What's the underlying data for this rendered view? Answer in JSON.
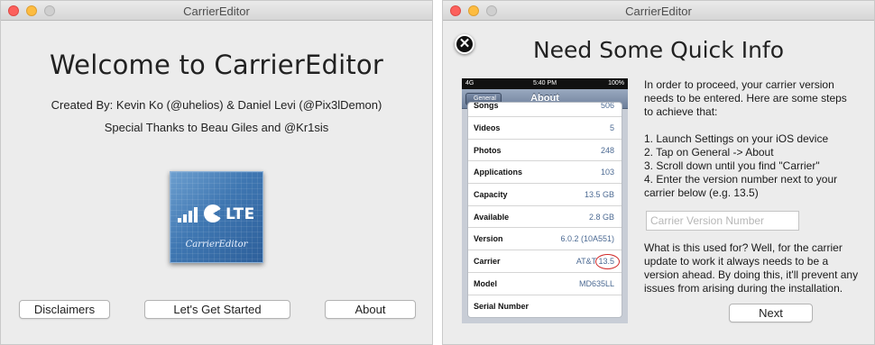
{
  "left_window": {
    "title": "CarrierEditor",
    "heading": "Welcome to CarrierEditor",
    "created_by": "Created By: Kevin Ko (@uhelios) & Daniel Levi (@Pix3lDemon)",
    "thanks": "Special Thanks to Beau Giles and @Kr1sis",
    "icon": {
      "name": "carriereditor-app-icon",
      "badge": "LTE",
      "label": "CarrierEditor"
    },
    "buttons": {
      "disclaimers": "Disclaimers",
      "started": "Let's Get Started",
      "about": "About"
    }
  },
  "right_window": {
    "title": "CarrierEditor",
    "heading": "Need Some Quick Info",
    "close_icon": "close-icon",
    "phone": {
      "status": {
        "network": "4G",
        "time": "5:40 PM",
        "battery": "100%"
      },
      "back": "General",
      "nav_title": "About",
      "rows": [
        {
          "key": "Songs",
          "value": "506"
        },
        {
          "key": "Videos",
          "value": "5"
        },
        {
          "key": "Photos",
          "value": "248"
        },
        {
          "key": "Applications",
          "value": "103"
        },
        {
          "key": "Capacity",
          "value": "13.5 GB"
        },
        {
          "key": "Available",
          "value": "2.8 GB"
        },
        {
          "key": "Version",
          "value": "6.0.2 (10A551)"
        },
        {
          "key": "Carrier",
          "value": "AT&T 13.5"
        },
        {
          "key": "Model",
          "value": "MD635LL"
        },
        {
          "key": "Serial Number",
          "value": ""
        }
      ]
    },
    "instructions": {
      "intro": "In order to proceed, your carrier version needs to be entered. Here are some steps to achieve that:",
      "steps": [
        "1. Launch Settings on your iOS device",
        "2. Tap on General -> About",
        "3. Scroll down until you find \"Carrier\"",
        "4. Enter the version number next to your carrier below (e.g. 13.5)"
      ]
    },
    "input": {
      "placeholder": "Carrier Version Number",
      "value": ""
    },
    "explanation": "What is this used for? Well, for the carrier update to work it always needs to be a version ahead. By doing this, it'll prevent any issues from arising during the installation.",
    "next_button": "Next"
  }
}
